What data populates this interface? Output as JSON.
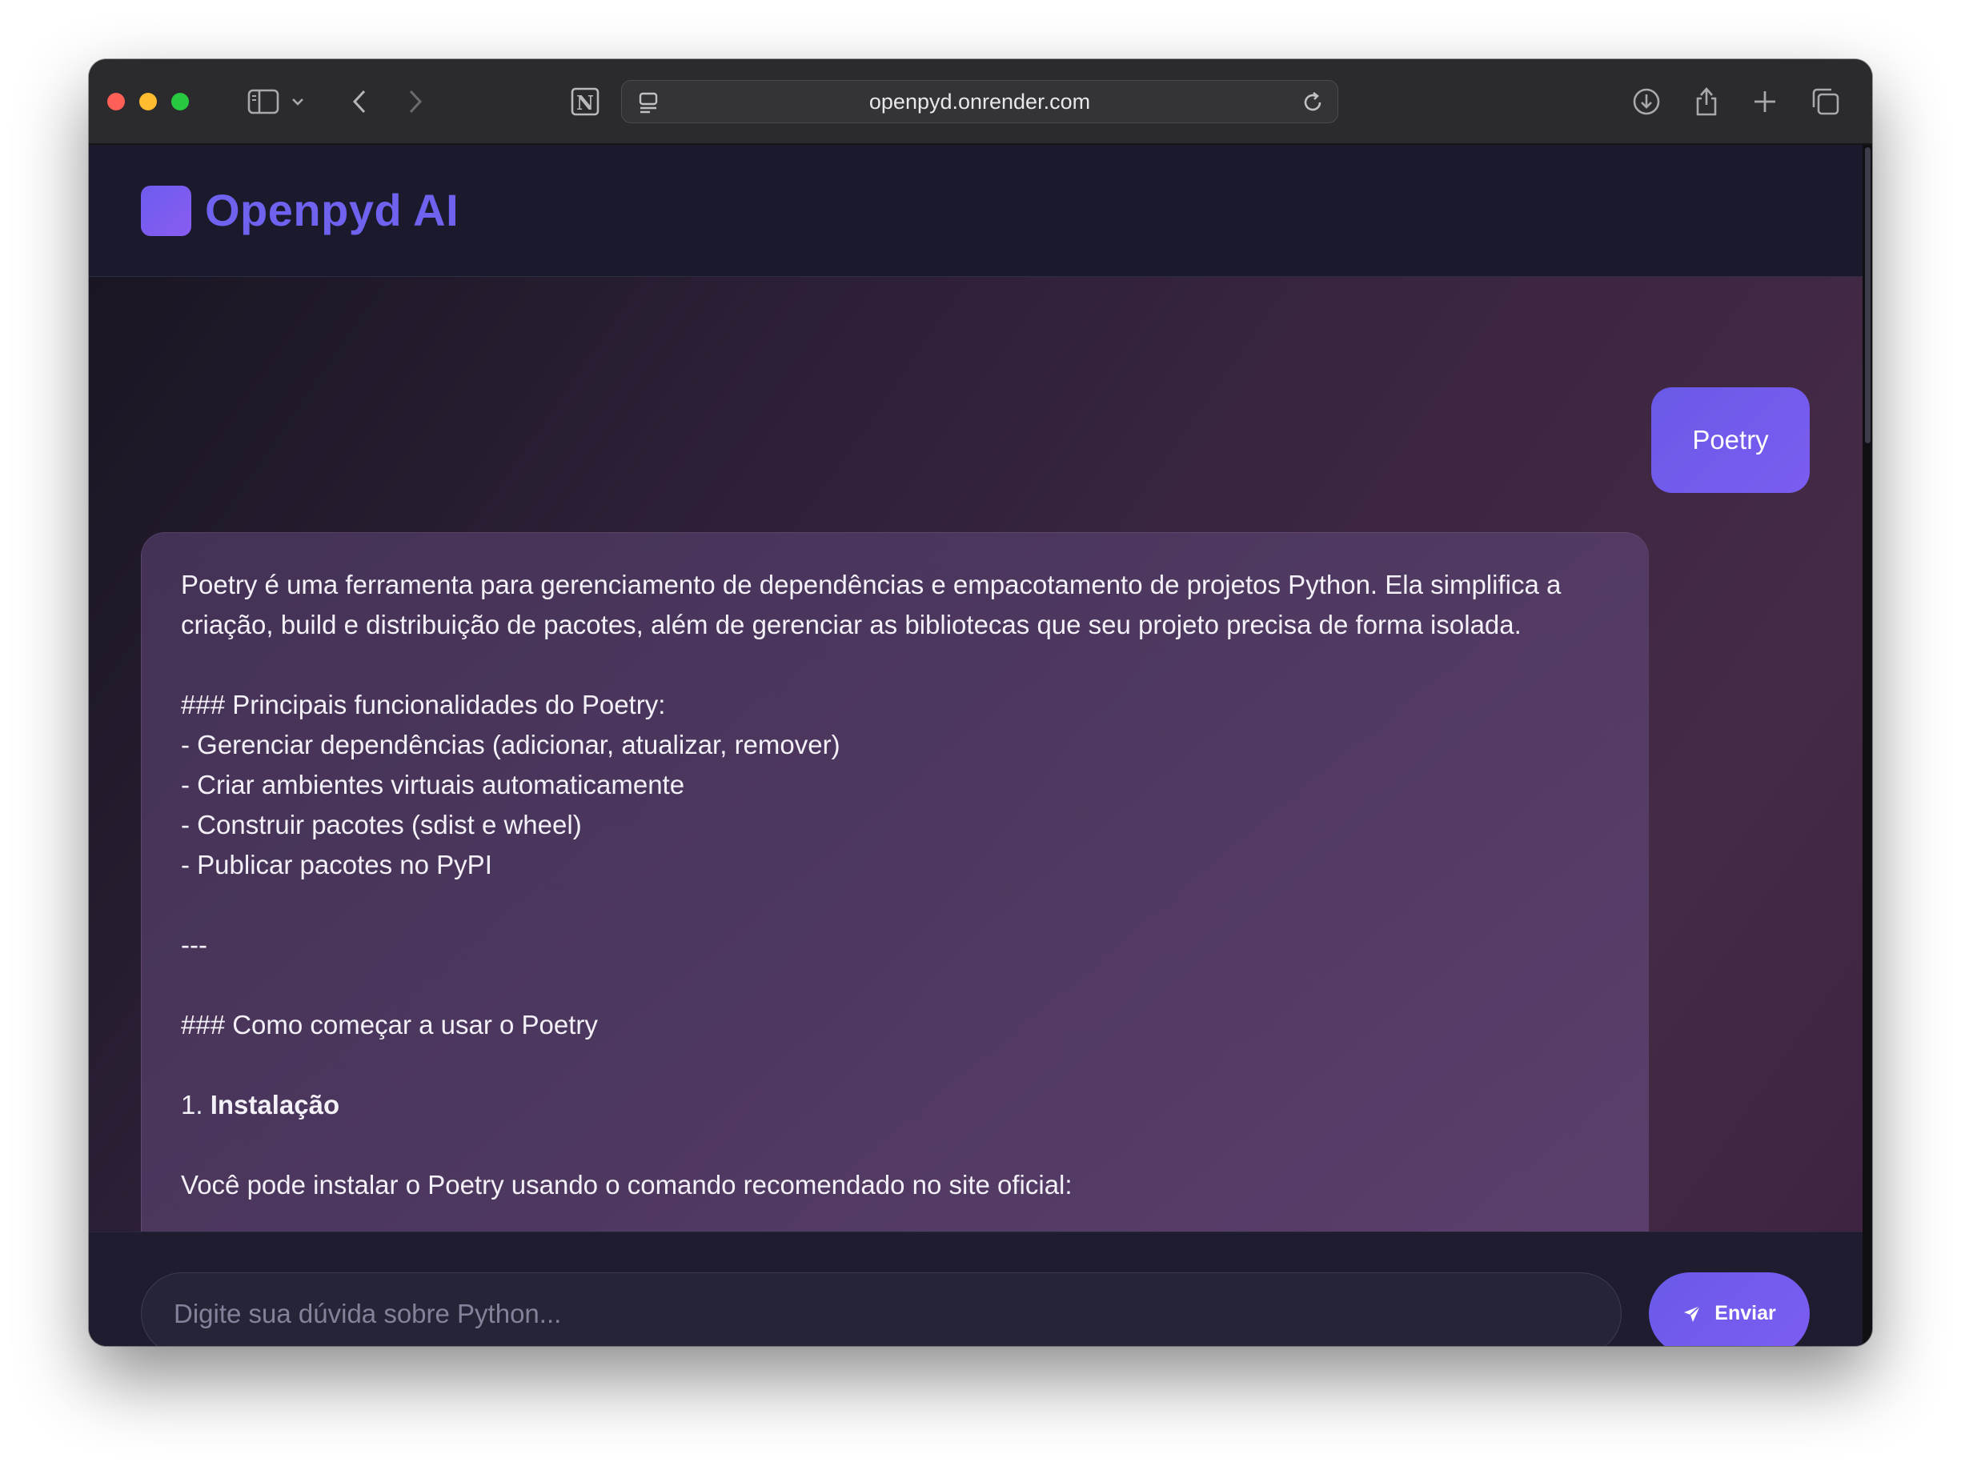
{
  "browser": {
    "url": "openpyd.onrender.com",
    "traffic_colors": [
      "#fe5f57",
      "#febc2e",
      "#28c840"
    ],
    "icons": [
      "sidebar-icon",
      "chevron-down-icon",
      "back-icon",
      "forward-icon",
      "notion-icon",
      "page-menu-icon",
      "reload-icon",
      "download-icon",
      "share-icon",
      "plus-icon",
      "tabs-icon"
    ]
  },
  "app": {
    "title": "Openpyd AI",
    "accent": "#6e62ee"
  },
  "chat": {
    "user_message": "Poetry",
    "bot_message": {
      "p1": "Poetry é uma ferramenta para gerenciamento de dependências e empacotamento de projetos Python. Ela simplifica a criação, build e distribuição de pacotes, além de gerenciar as bibliotecas que seu projeto precisa de forma isolada.",
      "h1": "### Principais funcionalidades do Poetry:",
      "li1": "- Gerenciar dependências (adicionar, atualizar, remover)",
      "li2": "- Criar ambientes virtuais automaticamente",
      "li3": "- Construir pacotes (sdist e wheel)",
      "li4": "- Publicar pacotes no PyPI",
      "sep": "---",
      "h2": "### Como começar a usar o Poetry",
      "step1_num": "1. ",
      "step1_title": "Instalação",
      "p2": "Você pode instalar o Poetry usando o comando recomendado no site oficial:"
    }
  },
  "composer": {
    "placeholder": "Digite sua dúvida sobre Python...",
    "send_label": "Enviar"
  }
}
